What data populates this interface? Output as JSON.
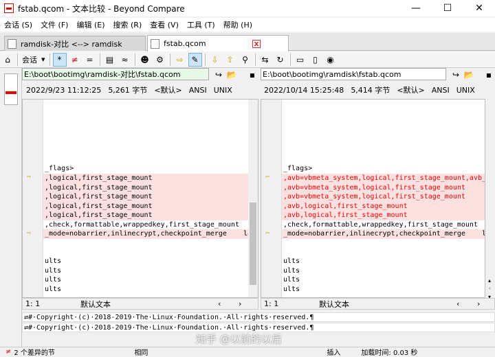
{
  "window": {
    "title": "fstab.qcom - 文本比较 - Beyond Compare",
    "minimize": "—",
    "maximize": "☐",
    "close": "✕"
  },
  "menu": [
    "会话 (S)",
    "文件 (F)",
    "编辑 (E)",
    "搜索 (R)",
    "查看 (V)",
    "工具 (T)",
    "帮助 (H)"
  ],
  "tabs": [
    {
      "label": "ramdisk-对比 <--> ramdisk"
    },
    {
      "label": "fstab.qcom",
      "close": "x"
    }
  ],
  "toolbar": {
    "session_label": "会话",
    "dropdown": "▾"
  },
  "left": {
    "path": "E:\\boot\\bootimg\\ramdisk-对比\\fstab.qcom",
    "date": "2022/9/23 11:12:25",
    "size": "5,261 字节",
    "encoding_default": "<默认>",
    "charset": "ANSI",
    "lineend": "UNIX",
    "status_pos": "1: 1",
    "status_text": "默认文本"
  },
  "right": {
    "path": "E:\\boot\\bootimg\\ramdisk\\fstab.qcom",
    "date": "2022/10/14 15:25:48",
    "size": "5,414 字节",
    "encoding_default": "<默认>",
    "charset": "ANSI",
    "lineend": "UNIX",
    "status_pos": "1: 1",
    "status_text": "默认文本"
  },
  "left_lines": [
    "_flags>",
    ",logical,first_stage_mount",
    ",logical,first_stage_mount",
    ",logical,first_stage_mount",
    ",logical,first_stage_mount",
    ",logical,first_stage_mount",
    ",check,formattable,wrappedkey,first_stage_mount",
    "_mode=nobarrier,inlinecrypt,checkpoint_merge    lat",
    "ults",
    "ults",
    "ults",
    "ults"
  ],
  "right_lines": [
    "_flags>",
    ",avb=vbmeta_system,logical,first_stage_mount,avb_k",
    ",avb=vbmeta_system,logical,first_stage_mount",
    ",avb=vbmeta_system,logical,first_stage_mount",
    ",avb,logical,first_stage_mount",
    ",avb,logical,first_stage_mount",
    ",check,formattable,wrappedkey,first_stage_mount",
    "_mode=nobarrier,inlinecrypt,checkpoint_merge    la",
    "ults",
    "ults",
    "ults",
    "ults"
  ],
  "bottom_compare": [
    "⇄#·Copyright·(c)·2018-2019·The·Linux·Foundation.·All·rights·reserved.¶",
    "⇄#·Copyright·(c)·2018-2019·The·Linux·Foundation.·All·rights·reserved.¶"
  ],
  "status": {
    "diff_count": "2 个差异的节",
    "same": "相同",
    "insert": "插入",
    "load_time": "加载时间:   0.03 秒"
  },
  "watermark": "知乎 @以前的以后"
}
